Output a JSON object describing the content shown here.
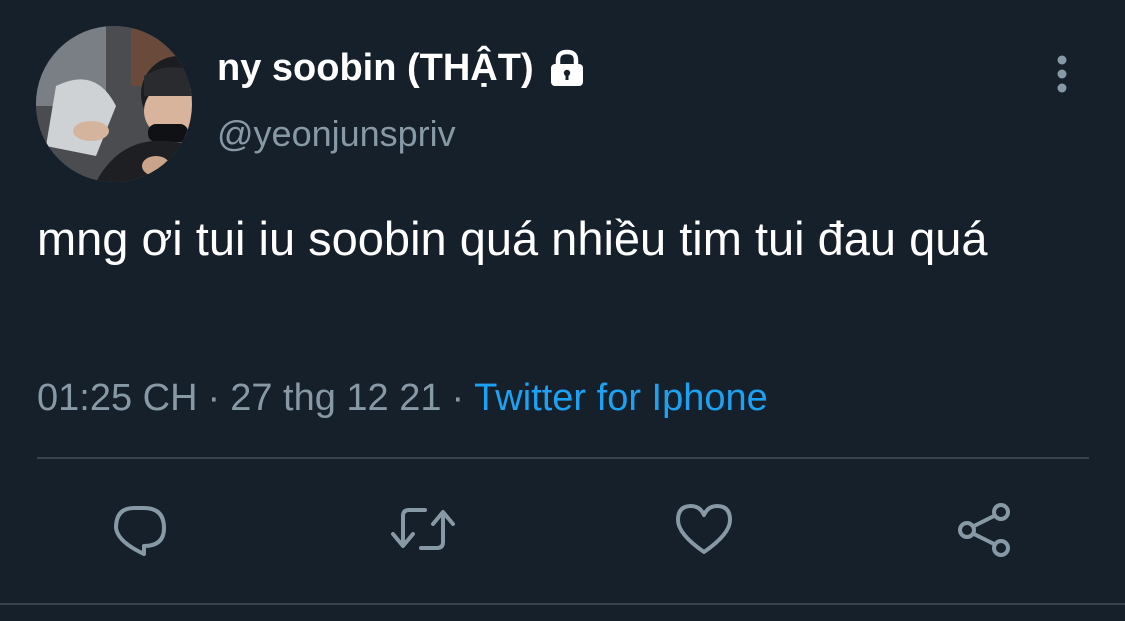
{
  "tweet": {
    "author": {
      "display_name": "ny soobin (THẬT)",
      "handle": "@yeonjunspriv",
      "protected_icon": "lock-icon",
      "avatar": "avatar-photo"
    },
    "text": "mng ơi tui iu soobin quá nhiều tim tui đau quá",
    "time": "01:25 CH",
    "date": "27 thg 12 21",
    "separator": "·",
    "source": "Twitter for Iphone"
  },
  "actions": [
    {
      "name": "reply",
      "icon": "reply-icon"
    },
    {
      "name": "retweet",
      "icon": "retweet-icon"
    },
    {
      "name": "like",
      "icon": "heart-icon"
    },
    {
      "name": "share",
      "icon": "share-icon"
    }
  ],
  "menu": {
    "icon": "more-vertical-icon"
  },
  "colors": {
    "background": "#15202b",
    "primary_text": "#ffffff",
    "secondary_text": "#8899a6",
    "accent": "#1da1f2",
    "divider": "#38444d"
  }
}
